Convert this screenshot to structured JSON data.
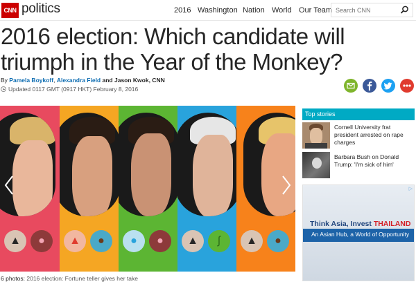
{
  "header": {
    "logo": "CNN",
    "section": "politics",
    "nav": [
      "2016",
      "Washington",
      "Nation",
      "World",
      "Our Team"
    ],
    "search_placeholder": "Search CNN"
  },
  "article": {
    "headline": "2016 election: Which candidate will triumph in the Year of the Monkey?",
    "byline_prefix": "By",
    "author1": "Pamela Boykoff",
    "author2": "Alexandra Field",
    "byline_suffix": "and Jason Kwok, CNN",
    "updated": "Updated 0117 GMT (0917 HKT) February 8, 2016"
  },
  "share": {
    "email_icon": "email-icon",
    "facebook_icon": "facebook-icon",
    "twitter_icon": "twitter-icon",
    "more_icon": "more-icon"
  },
  "gallery": {
    "panels": [
      {
        "color": "#e84a5f",
        "icons": [
          "mountain",
          "pig"
        ]
      },
      {
        "color": "#f5a623",
        "icons": [
          "fire",
          "dog"
        ]
      },
      {
        "color": "#5cb533",
        "icons": [
          "water",
          "pig"
        ]
      },
      {
        "color": "#29a3dc",
        "icons": [
          "mountain",
          "snake"
        ]
      },
      {
        "color": "#f7821b",
        "icons": [
          "mountain",
          "dog"
        ]
      }
    ],
    "caption_count": "6 photos:",
    "caption_text": "2016 election: Fortune teller gives her take"
  },
  "sidebar": {
    "heading": "Top stories",
    "stories": [
      {
        "title": "Cornell University frat president arrested on rape charges"
      },
      {
        "title": "Barbara Bush on Donald Trump: 'I'm sick of him'"
      }
    ]
  },
  "ad": {
    "title_part1": "Think Asia, Invest ",
    "title_part2": "THAILAND",
    "subtitle": "An Asian Hub, a World of Opportunity"
  }
}
